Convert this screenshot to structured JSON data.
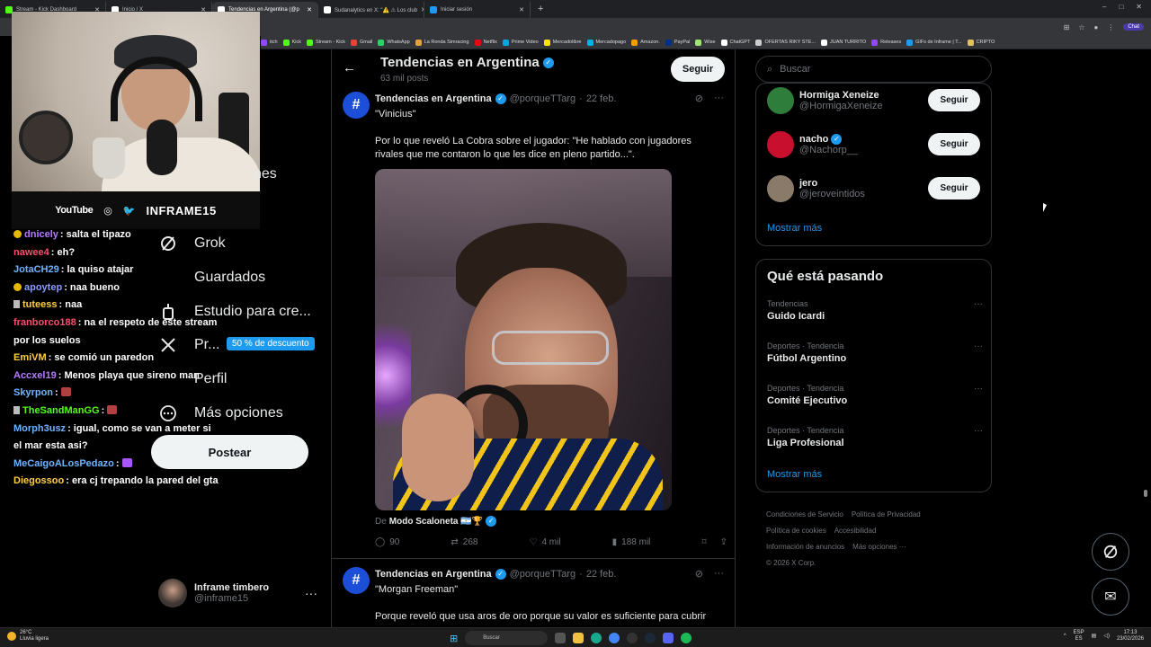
{
  "browser": {
    "tabs": [
      {
        "label": "Stream - Kick Dashboard",
        "color": "#53fc18",
        "active": false
      },
      {
        "label": "Inicio / X",
        "color": "#ffffff",
        "active": false
      },
      {
        "label": "Tendencias en Argentina (@p",
        "color": "#ffffff",
        "active": true
      },
      {
        "label": "Sudanalytics en X: \"⚠️ ⚠ Los club",
        "color": "#ffffff",
        "active": false
      },
      {
        "label": "Iniciar sesión",
        "color": "#1d9bf0",
        "active": false
      }
    ],
    "new_tab": "+",
    "controls": [
      "–",
      "□",
      "✕"
    ],
    "chat_label": "Chat",
    "bookmarks": [
      {
        "label": "itch",
        "color": "#9146ff"
      },
      {
        "label": "Kick",
        "color": "#53fc18"
      },
      {
        "label": "Stream - Kick",
        "color": "#53fc18"
      },
      {
        "label": "Gmail",
        "color": "#ea4335"
      },
      {
        "label": "WhatsApp",
        "color": "#25d366"
      },
      {
        "label": "La Ronda Simracing",
        "color": "#e8a13a"
      },
      {
        "label": "Netflix",
        "color": "#e50914"
      },
      {
        "label": "Prime Video",
        "color": "#00a8e1"
      },
      {
        "label": "Mercadolibre",
        "color": "#ffe600"
      },
      {
        "label": "Mercadopago",
        "color": "#00b1ea"
      },
      {
        "label": "Amazon.",
        "color": "#ff9900"
      },
      {
        "label": "PayPal",
        "color": "#003087"
      },
      {
        "label": "Wise",
        "color": "#9fe870"
      },
      {
        "label": "ChatGPT",
        "color": "#ffffff"
      },
      {
        "label": "OFERTAS RIKY STE...",
        "color": "#cccccc"
      },
      {
        "label": "JUAN TURRITO",
        "color": "#ffffff"
      },
      {
        "label": "Releases",
        "color": "#9146ff"
      },
      {
        "label": "GIFs de Inframe | T...",
        "color": "#1d9bf0"
      },
      {
        "label": "CRIPTO",
        "color": "#e0c060"
      }
    ]
  },
  "overlay": {
    "youtube": "YouTube",
    "brand": "INFRAME15"
  },
  "chat": [
    {
      "user": "dnicely",
      "color": "#b57cff",
      "text": "salta el tipazo",
      "badge": "coin"
    },
    {
      "user": "nawee4",
      "color": "#ff4d6d",
      "text": "eh?"
    },
    {
      "user": "JotaCH29",
      "color": "#6fb3ff",
      "text": "la quiso atajar"
    },
    {
      "user": "apoytep",
      "color": "#8a9cff",
      "text": "naa bueno",
      "badge": "coin"
    },
    {
      "user": "tuteess",
      "color": "#ffcf3f",
      "text": "naa",
      "badge": "pin"
    },
    {
      "user": "franborco188",
      "color": "#ff4d6d",
      "text": "na el respeto de este stream por los suelos"
    },
    {
      "user": "EmiVM",
      "color": "#ffcf3f",
      "text": "se comió un paredon"
    },
    {
      "user": "Accxel19",
      "color": "#b57cff",
      "text": "Menos playa que sireno man"
    },
    {
      "user": "Skyrpon",
      "color": "#6fb3ff",
      "text": "",
      "emote": "#b04040"
    },
    {
      "user": "TheSandManGG",
      "color": "#53fc18",
      "text": "",
      "emote": "#b04040",
      "badge": "pin"
    },
    {
      "user": "Morph3usz",
      "color": "#6fb3ff",
      "text": "igual, como se van a meter si el mar esta asi?"
    },
    {
      "user": "MeCaigoALosPedazo",
      "color": "#6fb3ff",
      "text": "",
      "emote": "#a855f7"
    },
    {
      "user": "Diegossoo",
      "color": "#ffcf3f",
      "text": "era cj trepando la pared del gta"
    }
  ],
  "nav": {
    "partial_item": "nes",
    "grok": "Grok",
    "saved": "Guardados",
    "studio": "Estudio para cre...",
    "premium": "Pr...",
    "premium_badge": "50 % de descuento",
    "profile": "Perfil",
    "more": "Más opciones",
    "post_button": "Postear"
  },
  "account": {
    "name": "Inframe timbero",
    "handle": "@inframe15",
    "more": "···"
  },
  "header": {
    "title": "Tendencias en Argentina",
    "posts": "63 mil posts",
    "follow": "Seguir"
  },
  "tweets": [
    {
      "author": "Tendencias en Argentina",
      "handle": "@porqueTTarg",
      "date": "22 feb.",
      "title": "\"Vinicius\"",
      "text": "Por lo que reveló La Cobra sobre el jugador: \"He hablado con jugadores rivales que me contaron lo que les dice en pleno partido...\".",
      "from_prefix": "De",
      "from_source": "Modo Scaloneta 🇦🇷🏆",
      "replies": "90",
      "reposts": "268",
      "likes": "4 mil",
      "views": "188 mil"
    },
    {
      "author": "Tendencias en Argentina",
      "handle": "@porqueTTarg",
      "date": "22 feb.",
      "title": "\"Morgan Freeman\"",
      "text": "Porque reveló que usa aros de oro porque su valor es suficiente para cubrir"
    }
  ],
  "search": {
    "placeholder": "Buscar"
  },
  "who_to_follow": [
    {
      "name": "Hormiga Xeneize",
      "handle": "@HormigaXeneize",
      "verified": false,
      "color": "#2f7d3a",
      "follow": "Seguir"
    },
    {
      "name": "nacho",
      "handle": "@Nachorp__",
      "verified": true,
      "color": "#c8102e",
      "follow": "Seguir"
    },
    {
      "name": "jero",
      "handle": "@jeroveintidos",
      "verified": false,
      "color": "#8a7a6a",
      "follow": "Seguir"
    }
  ],
  "show_more": "Mostrar más",
  "trends": {
    "title": "Qué está pasando",
    "items": [
      {
        "category": "Tendencias",
        "name": "Guido Icardi"
      },
      {
        "category": "Deportes · Tendencia",
        "name": "Fútbol Argentino"
      },
      {
        "category": "Deportes · Tendencia",
        "name": "Comité Ejecutivo"
      },
      {
        "category": "Deportes · Tendencia",
        "name": "Liga Profesional"
      }
    ],
    "show_more": "Mostrar más"
  },
  "footer": [
    "Condiciones de Servicio",
    "Política de Privacidad",
    "Política de cookies",
    "Accesibilidad",
    "Información de anuncios",
    "Más opciones ···",
    "© 2026 X Corp."
  ],
  "taskbar": {
    "temp": "26°C",
    "weather": "Lluvia ligera",
    "search": "Buscar",
    "lang1": "ESP",
    "lang2": "ES",
    "time": "17:13",
    "date": "23/02/2026"
  }
}
